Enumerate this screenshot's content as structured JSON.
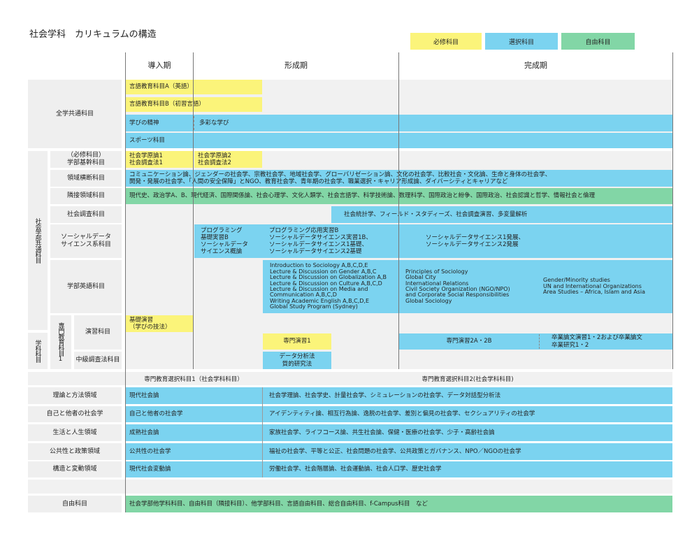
{
  "title": "社会学科　カリキュラムの構造",
  "legend": {
    "required": "必修科目",
    "elective": "選択科目",
    "free": "自由科目"
  },
  "phases": {
    "intro": "導入期",
    "formation": "形成期",
    "completion": "完成期"
  },
  "rows": {
    "all_school": {
      "label": "全学共通科目",
      "lang_a": "言語教育科目A（英語）",
      "lang_b": "言語教育科目B（初習言語）",
      "spirit": "学びの精神",
      "diverse": "多彩な学び",
      "sports": "スポーツ科目"
    },
    "faculty_common": {
      "label": "社会学部共通科目",
      "basic_label": "（必修科目）\n学部基幹科目",
      "basic_1": "社会学原論1\n社会調査法1",
      "basic_2": "社会学原論2\n社会調査法2",
      "cross_label": "領域横断科目",
      "cross_text": "コミュニケーション論、ジェンダーの社会学、宗教社会学、地域社会学、グローバリゼーション論、文化の社会学、比較社会・文化論、生命と身体の社会学、\n開発・発展の社会学、「人間の安全保障」とNGO、教育社会学、青年期の社会学、職業選択・キャリア形成論、ダイバーシティとキャリアなど",
      "adj_label": "隣接領域科目",
      "adj_text": "現代史、政治学A、B、現代経済、国際関係論、社会心理学、文化人類学、社会言語学、科学技術論、数理科学、国際政治と紛争、国際政治、社会認識と哲学、情報社会と倫理",
      "survey_label": "社会調査科目",
      "survey_text": "社会統計学、フィールド・スタディーズ、社会調査演習、多変量解析",
      "ds_label": "ソーシャルデータ\nサイエンス系科目",
      "ds_1": "プログラミング\n基礎実習B\nソーシャルデータ\nサイエンス概論",
      "ds_2": "プログラミング応用実習B\nソーシャルデータサイエンス実習1B、\nソーシャルデータサイエンス1基礎、\nソーシャルデータサイエンス2基礎",
      "ds_3": "ソーシャルデータサイエンス1発展、\nソーシャルデータサイエンス2発展",
      "eng_label": "学部英語科目",
      "eng_1": "Introduction to Sociology A,B,C,D,E\nLecture & Discussion on Gender A,B,C\nLecture & Discussion on Globalization A,B\nLecture & Discussion on Culture A,B,C,D\nLecture & Discussion on Media and\nCommunication A,B,C,D\nWriting Academic English A,B,C,D,E\nGlobal Study Program (Sydney)",
      "eng_2": "Principles of Sociology\nGlobal City\nInternational Relations\nCivil Society Organization (NGO/NPO)\nand Corporate Social Responsibilities\nGlobal Sociology",
      "eng_3": "Gender/Minority studies\nUN and International Organizations\nArea Studies – Africa, Islam and Asia"
    },
    "dept": {
      "label": "学科科目",
      "sub_label": "専門教育科目1",
      "seminar_label": "演習科目",
      "seminar_basic": "基礎演習\n（学びの技法）",
      "seminar_1": "専門演習1",
      "seminar_2": "専門演習2A・2B",
      "seminar_3": "卒業論文演習1・2および卒業論文\n卒業研究1・2",
      "advsurvey_label": "中級調査法科目",
      "advsurvey_text": "データ分析法\n質的研究法"
    },
    "specialized": {
      "header_1": "専門教育選択科目1（社会学科科目）",
      "header_2": "専門教育選択科目2(社会学科科目)",
      "areas": [
        {
          "label": "理論と方法領域",
          "left": "現代社会論",
          "right": "社会学理論、社会学史、計量社会学、シミュレーションの社会学、データ対話型分析法"
        },
        {
          "label": "自己と他者の社会学",
          "left": "自己と他者の社会学",
          "right": "アイデンティティ論、相互行為論、逸脱の社会学、差別と偏見の社会学、セクシュアリティの社会学"
        },
        {
          "label": "生活と人生領域",
          "left": "成熟社会論",
          "right": "家族社会学、ライフコース論、共生社会論、保健・医療の社会学、少子・高齢社会論"
        },
        {
          "label": "公共性と政策領域",
          "left": "公共性の社会学",
          "right": "福祉の社会学、平等と公正、社会問題の社会学、公共政策とガバナンス、NPO／NGOの社会学"
        },
        {
          "label": "構造と変動領域",
          "left": "現代社会変動論",
          "right": "労働社会学、社会階層論、社会運動論、社会人口学、歴史社会学"
        }
      ]
    },
    "free": {
      "label": "自由科目",
      "text": "社会学部他学科科目、自由科目（隣接科目）、他学部科目、言語自由科目、総合自由科目、f-Campus科目　など"
    }
  },
  "colors": {
    "required": "#fbf47a",
    "elective": "#7bd3f0",
    "free": "#82d6a6",
    "label_bg": "#efefef",
    "empty_bg": "#f1f1f1"
  }
}
